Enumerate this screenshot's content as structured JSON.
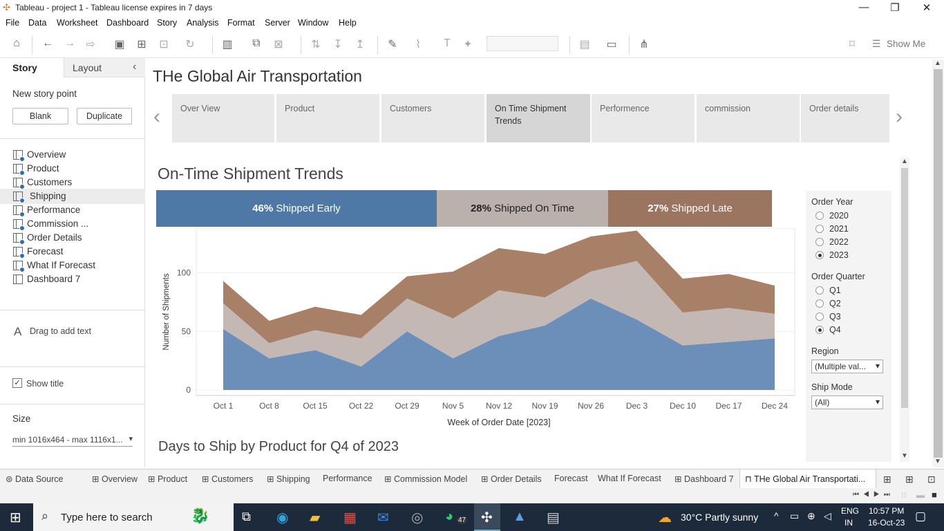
{
  "window": {
    "title": "Tableau - project 1 - Tableau license expires in 7 days",
    "minimize": "—",
    "restore": "❐",
    "close": "✕"
  },
  "menu": [
    "File",
    "Data",
    "Worksheet",
    "Dashboard",
    "Story",
    "Analysis",
    "Format",
    "Server",
    "Window",
    "Help"
  ],
  "toolbar": {
    "show_me": "Show Me"
  },
  "left": {
    "tab_story": "Story",
    "tab_layout": "Layout",
    "new_story_point": "New story point",
    "blank": "Blank",
    "duplicate": "Duplicate",
    "sheets": [
      "Overview",
      "Product",
      "Customers",
      "Shipping",
      "Performance",
      "Commission ...",
      "Order Details",
      "Forecast",
      "What If Forecast",
      "Dashboard 7"
    ],
    "drag_text": "Drag to add text",
    "show_title": "Show title",
    "size_label": "Size",
    "size_value": "min 1016x464 - max 1116x1..."
  },
  "story": {
    "title": "THe Global Air Transportation",
    "points": [
      "Over View",
      "Product",
      "Customers",
      "On Time Shipment Trends",
      "Performence",
      "commission",
      "Order details"
    ],
    "selected_point": 3
  },
  "dashboard": {
    "title": "On-Time Shipment Trends",
    "kpis": [
      {
        "pct": "46%",
        "label": "Shipped Early",
        "color": "#4e79a7"
      },
      {
        "pct": "28%",
        "label": "Shipped On Time",
        "color": "#bab0ac"
      },
      {
        "pct": "27%",
        "label": "Shipped Late",
        "color": "#9c7560"
      }
    ],
    "second_title": "Days to Ship by Product for Q4 of 2023"
  },
  "filters": {
    "order_year_label": "Order Year",
    "years": [
      "2020",
      "2021",
      "2022",
      "2023"
    ],
    "year_selected": "2023",
    "order_quarter_label": "Order Quarter",
    "quarters": [
      "Q1",
      "Q2",
      "Q3",
      "Q4"
    ],
    "quarter_selected": "Q4",
    "region_label": "Region",
    "region_value": "(Multiple val...",
    "ship_mode_label": "Ship Mode",
    "ship_mode_value": "(All)"
  },
  "chart_data": {
    "type": "area",
    "xlabel": "Week of Order Date [2023]",
    "ylabel": "Number of Shipments",
    "categories": [
      "Oct 1",
      "Oct 8",
      "Oct 15",
      "Oct 22",
      "Oct 29",
      "Nov 5",
      "Nov 12",
      "Nov 19",
      "Nov 26",
      "Dec 3",
      "Dec 10",
      "Dec 17",
      "Dec 24"
    ],
    "ylim": [
      0,
      140
    ],
    "yticks": [
      0,
      50,
      100
    ],
    "stacked": true,
    "series": [
      {
        "name": "Shipped Early",
        "color": "#6b8fb8",
        "values": [
          52,
          27,
          34,
          20,
          50,
          27,
          46,
          55,
          78,
          60,
          38,
          41,
          44
        ]
      },
      {
        "name": "Shipped On Time",
        "color": "#c4b8b4",
        "values": [
          22,
          13,
          17,
          24,
          28,
          34,
          39,
          24,
          23,
          50,
          28,
          29,
          21
        ]
      },
      {
        "name": "Shipped Late",
        "color": "#a87f67",
        "values": [
          19,
          19,
          20,
          20,
          19,
          40,
          36,
          37,
          30,
          26,
          29,
          29,
          24
        ]
      }
    ],
    "grid": true
  },
  "bottom_tabs": [
    "Data Source",
    "Overview",
    "Product",
    "Customers",
    "Shipping",
    "Performance",
    "Commission Model",
    "Order Details",
    "Forecast",
    "What If Forecast",
    "Dashboard 7",
    "THe Global Air Transportati..."
  ],
  "taskbar": {
    "search": "Type here to search",
    "weather": "30°C  Partly sunny",
    "lang1": "ENG",
    "lang2": "IN",
    "time": "10:57 PM",
    "date": "16-Oct-23",
    "badge": "47"
  }
}
